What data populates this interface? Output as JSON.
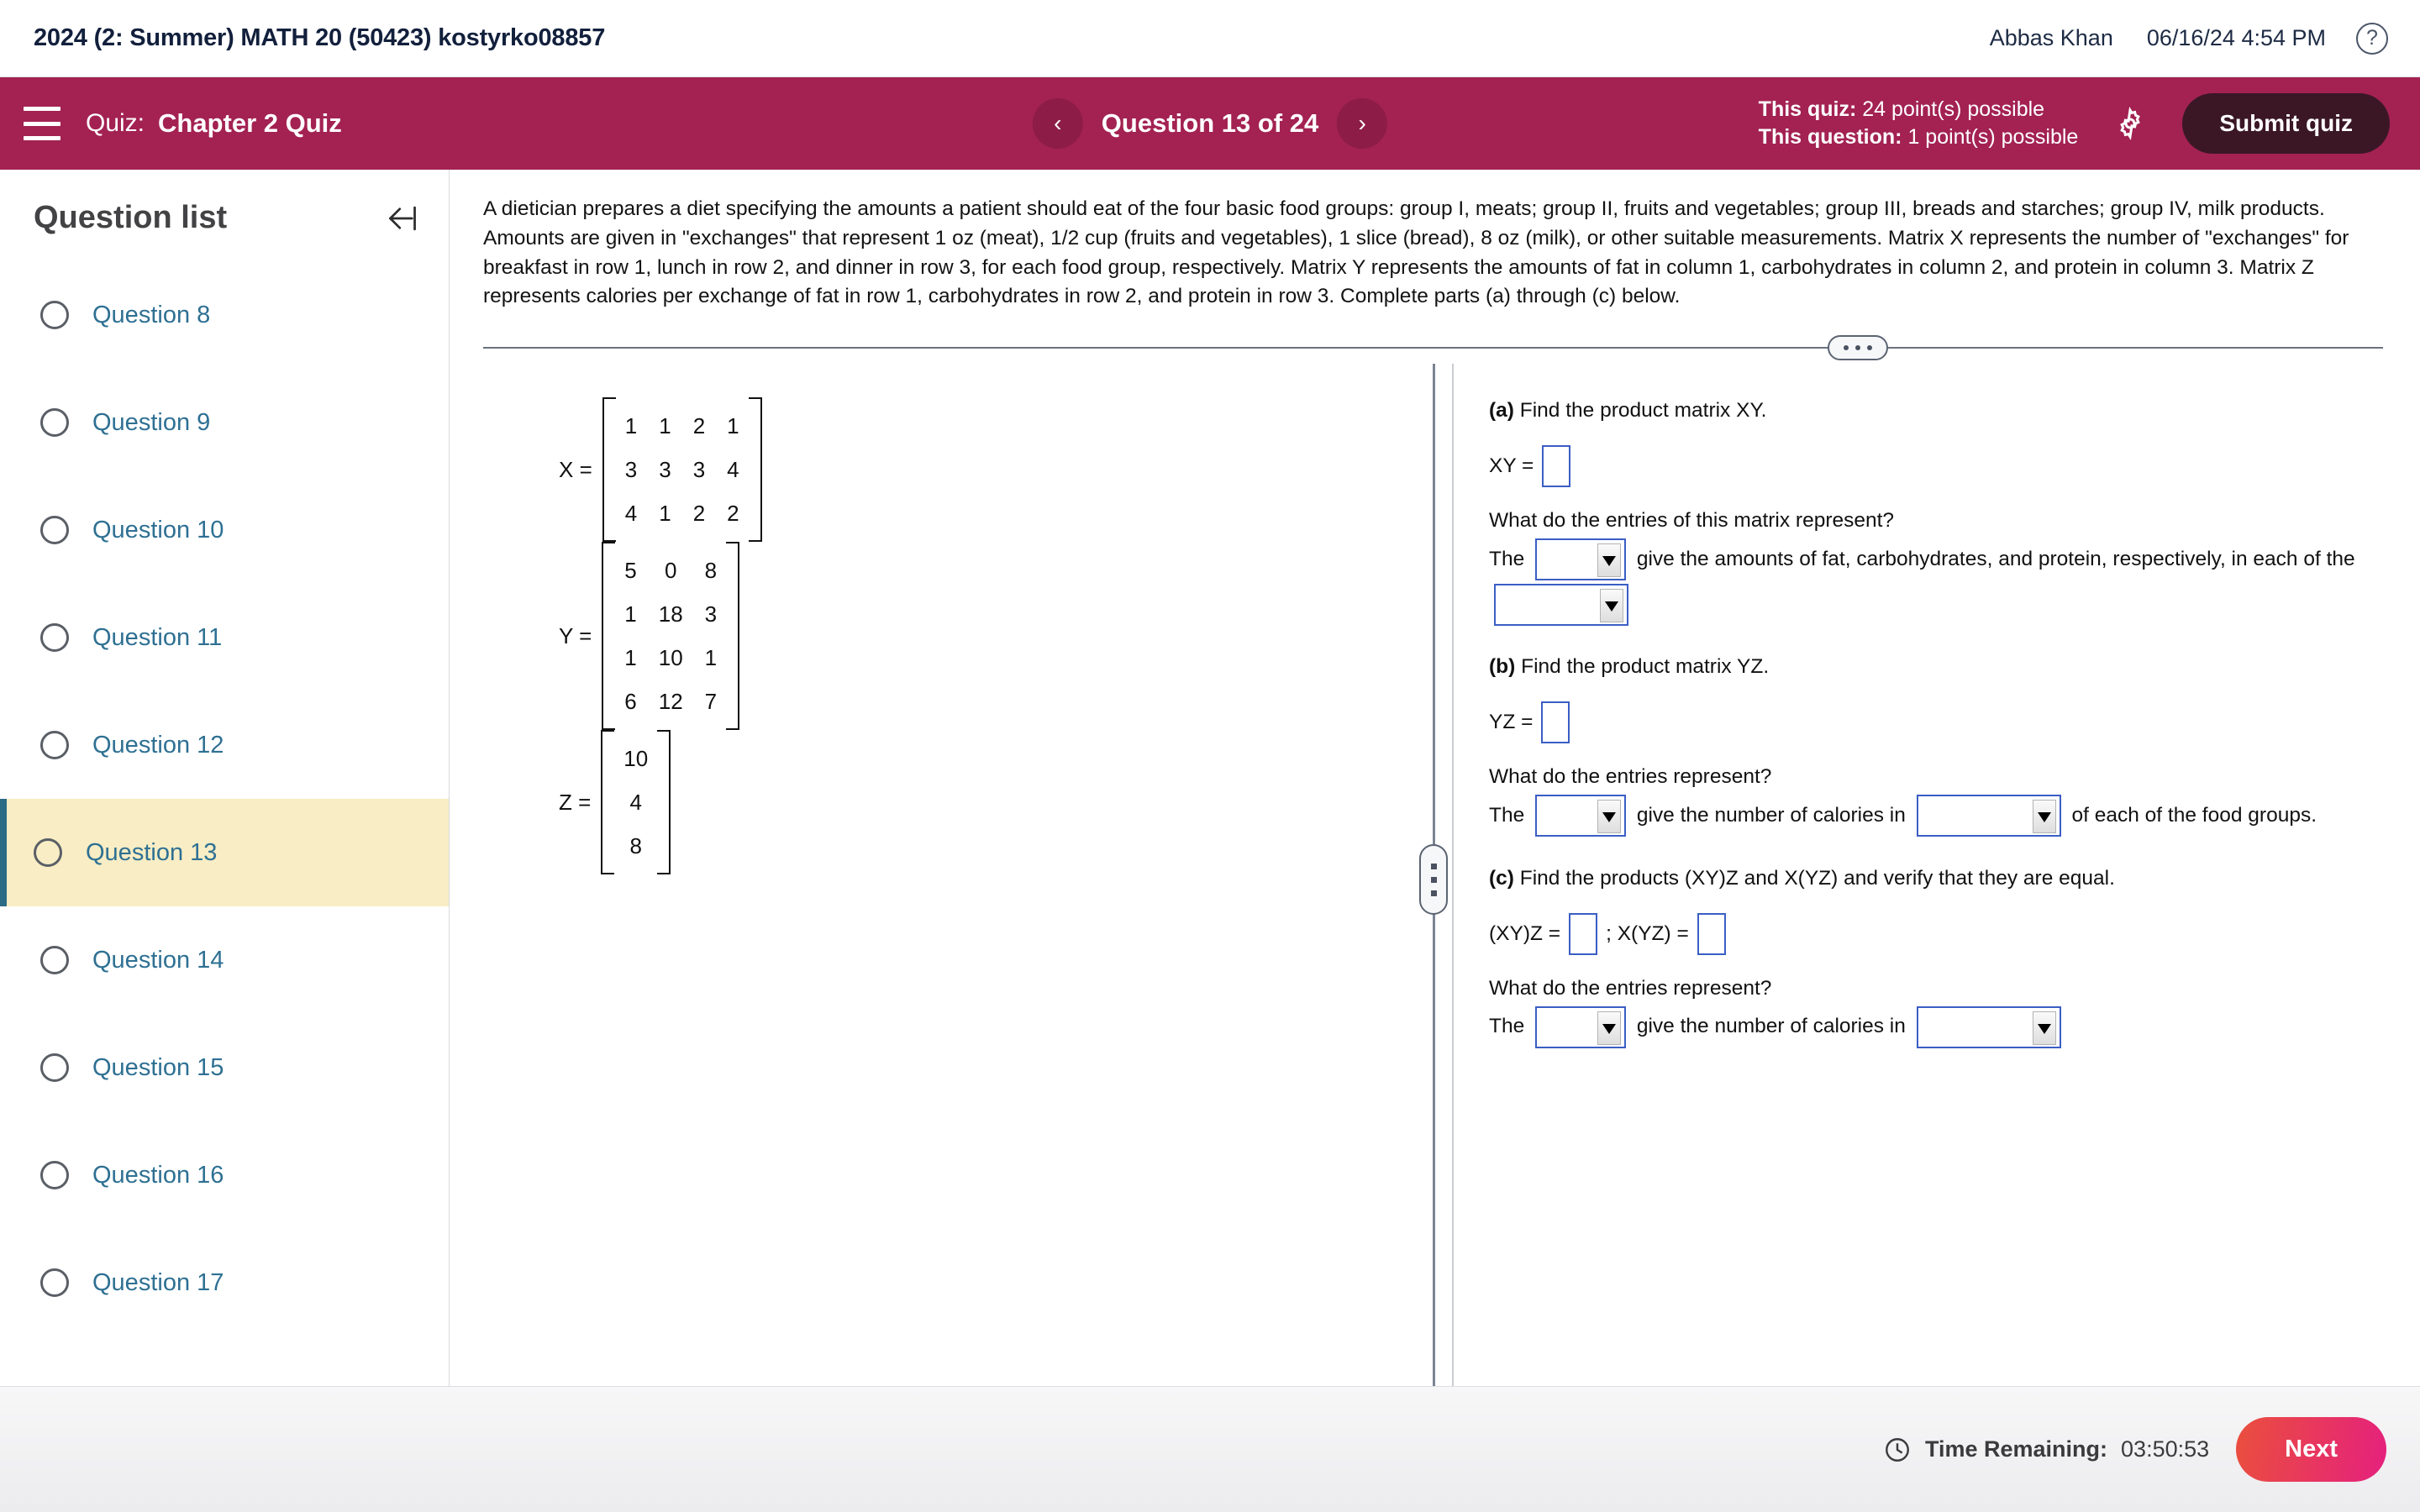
{
  "header": {
    "course_title": "2024 (2: Summer) MATH 20 (50423) kostyrko08857",
    "user_name": "Abbas Khan",
    "datetime": "06/16/24 4:54 PM",
    "help_icon": "question-mark-circle-icon"
  },
  "quizbar": {
    "menu_icon": "hamburger-menu-icon",
    "quiz_label": "Quiz:",
    "quiz_name": "Chapter 2 Quiz",
    "prev_icon": "chevron-left-icon",
    "next_icon": "chevron-right-icon",
    "question_counter": "Question 13 of 24",
    "this_quiz_label": "This quiz:",
    "this_quiz_value": "24 point(s) possible",
    "this_question_label": "This question:",
    "this_question_value": "1 point(s) possible",
    "settings_icon": "gear-icon",
    "submit_label": "Submit quiz",
    "accent_color": "#a32252",
    "submit_color": "#3b1726"
  },
  "sidebar": {
    "title": "Question list",
    "collapse_icon": "collapse-left-icon",
    "selected_index": 5,
    "items": [
      {
        "label": "Question 8"
      },
      {
        "label": "Question 9"
      },
      {
        "label": "Question 10"
      },
      {
        "label": "Question 11"
      },
      {
        "label": "Question 12"
      },
      {
        "label": "Question 13"
      },
      {
        "label": "Question 14"
      },
      {
        "label": "Question 15"
      },
      {
        "label": "Question 16"
      },
      {
        "label": "Question 17"
      }
    ],
    "selected_bg": "#f8edc4",
    "selected_border": "#2b6b85",
    "link_color": "#2e7093"
  },
  "stem": {
    "text": "A dietician prepares a diet specifying the amounts a patient should eat of the four basic food groups: group I, meats; group II, fruits and vegetables; group III, breads and starches; group IV, milk products. Amounts are given in \"exchanges\" that represent 1 oz (meat), 1/2 cup (fruits and vegetables), 1 slice (bread), 8 oz (milk), or other suitable measurements. Matrix X represents the number of \"exchanges\" for breakfast in row 1, lunch in row 2, and dinner in row 3, for each food group, respectively. Matrix Y represents the amounts of fat in column 1, carbohydrates in column 2, and protein in column 3. Matrix Z represents calories per exchange of fat in row 1, carbohydrates in row 2, and protein in row 3. Complete parts (a) through (c) below."
  },
  "matrices": [
    {
      "name": "X =",
      "rows": [
        [
          1,
          1,
          2,
          1
        ],
        [
          3,
          3,
          3,
          4
        ],
        [
          4,
          1,
          2,
          2
        ]
      ],
      "cols": 4
    },
    {
      "name": "Y =",
      "rows": [
        [
          5,
          0,
          8
        ],
        [
          1,
          18,
          3
        ],
        [
          1,
          10,
          1
        ],
        [
          6,
          12,
          7
        ]
      ],
      "cols": 3
    },
    {
      "name": "Z =",
      "rows": [
        [
          10
        ],
        [
          4
        ],
        [
          8
        ]
      ],
      "cols": 1
    }
  ],
  "parts": {
    "a": {
      "prompt_label": "(a)",
      "prompt_text": " Find the product matrix XY.",
      "answer_label": "XY =",
      "sub_question": "What do the entries of this matrix represent?",
      "sentence_1": "The",
      "sentence_2": "give the amounts of fat, carbohydrates, and protein, respectively, in each",
      "sentence_3": "of the"
    },
    "b": {
      "prompt_label": "(b)",
      "prompt_text": " Find the product matrix YZ.",
      "answer_label": "YZ =",
      "sub_question": "What do the entries represent?",
      "sentence_1": "The",
      "sentence_2": "give the number of calories in",
      "sentence_3": "of each of the food",
      "sentence_4": "groups."
    },
    "c": {
      "prompt_label": "(c)",
      "prompt_text": " Find the products (XY)Z and X(YZ) and verify that they are equal.",
      "answer_label_1": "(XY)Z =",
      "answer_sep": "; X(YZ) =",
      "sub_question": "What do the entries represent?",
      "sentence_1": "The",
      "sentence_2": "give the number of calories in"
    }
  },
  "splitters": {
    "horizontal_handle_icon": "drag-handle-dots-horizontal-icon",
    "vertical_handle_icon": "drag-handle-dots-vertical-icon"
  },
  "footer": {
    "clock_icon": "clock-icon",
    "time_label": "Time Remaining:",
    "time_value": "03:50:53",
    "next_label": "Next",
    "next_gradient_start": "#ea4f3d",
    "next_gradient_end": "#e5207e"
  }
}
